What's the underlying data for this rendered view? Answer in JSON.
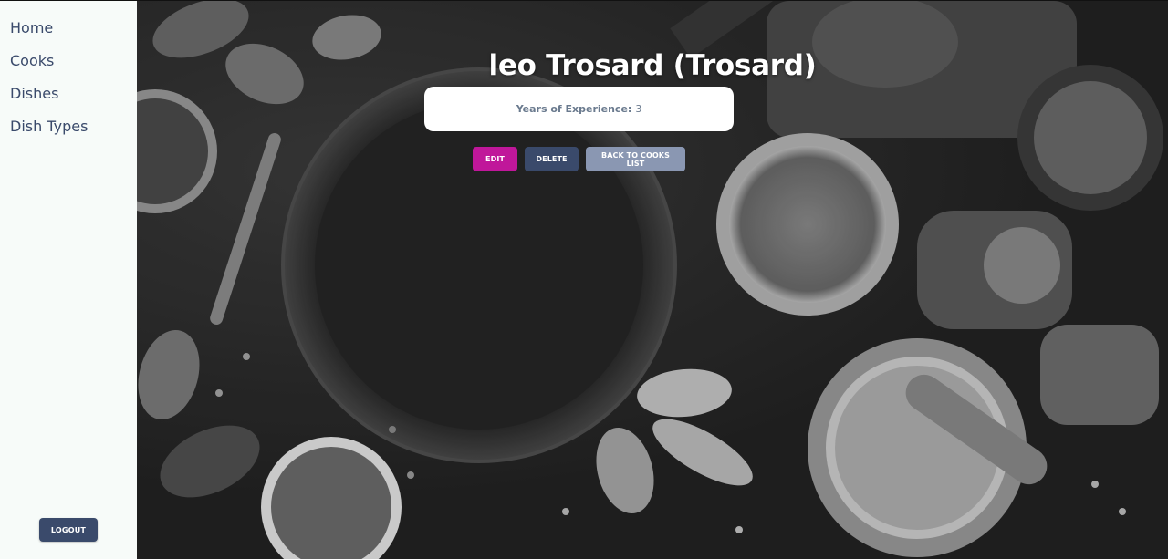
{
  "nav": {
    "items": [
      {
        "label": "Home"
      },
      {
        "label": "Cooks"
      },
      {
        "label": "Dishes"
      },
      {
        "label": "Dish Types"
      }
    ],
    "logout_label": "LOGOUT"
  },
  "cook": {
    "title": "leo Trosard (Trosard)",
    "experience_label": "Years of Experience:",
    "experience_value": "3"
  },
  "actions": {
    "edit_label": "EDIT",
    "delete_label": "DELETE",
    "back_label": "BACK TO COOKS LIST"
  },
  "colors": {
    "accent": "#c0179a",
    "primary": "#3a4a6b",
    "secondary": "#8a97b2",
    "sidebar_bg": "#f7fbf9"
  }
}
